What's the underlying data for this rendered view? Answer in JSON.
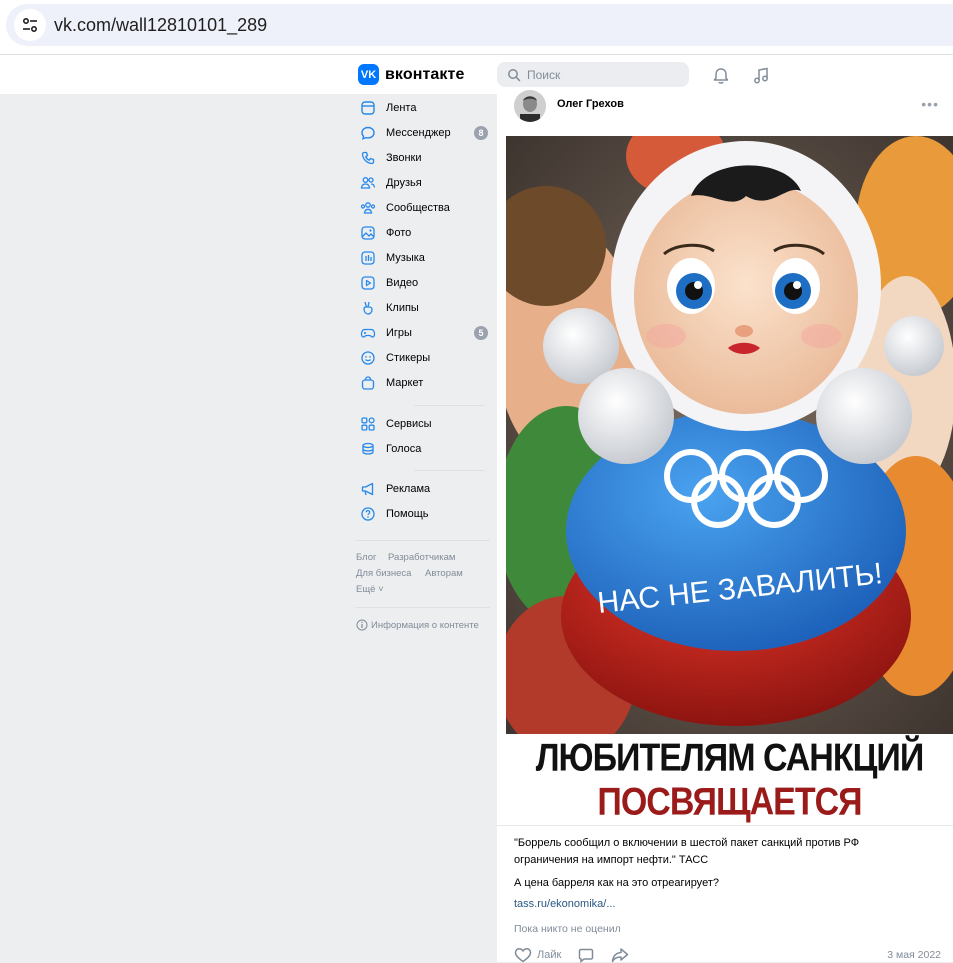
{
  "browser": {
    "url": "vk.com/wall12810101_289"
  },
  "header": {
    "logo_text": "вконтакте",
    "logo_mark": "VK",
    "search_placeholder": "Поиск",
    "icons": [
      "bell-icon",
      "music-icon"
    ]
  },
  "sidebar": {
    "items": [
      {
        "label": "Лента",
        "icon": "news-icon"
      },
      {
        "label": "Мессенджер",
        "icon": "chat-icon",
        "badge": "8"
      },
      {
        "label": "Звонки",
        "icon": "phone-icon"
      },
      {
        "label": "Друзья",
        "icon": "friends-icon"
      },
      {
        "label": "Сообщества",
        "icon": "communities-icon"
      },
      {
        "label": "Фото",
        "icon": "photo-icon"
      },
      {
        "label": "Музыка",
        "icon": "music-icon"
      },
      {
        "label": "Видео",
        "icon": "video-icon"
      },
      {
        "label": "Клипы",
        "icon": "clips-icon"
      },
      {
        "label": "Игры",
        "icon": "games-icon",
        "badge": "5"
      },
      {
        "label": "Стикеры",
        "icon": "smile-icon"
      },
      {
        "label": "Маркет",
        "icon": "bag-icon"
      }
    ],
    "items2": [
      {
        "label": "Сервисы",
        "icon": "grid-icon"
      },
      {
        "label": "Голоса",
        "icon": "coins-icon"
      }
    ],
    "items3": [
      {
        "label": "Реклама",
        "icon": "megaphone-icon"
      },
      {
        "label": "Помощь",
        "icon": "help-icon"
      }
    ],
    "footer": {
      "blog": "Блог",
      "developers": "Разработчикам",
      "business": "Для бизнеса",
      "authors": "Авторам",
      "more": "Ещё ˅",
      "content_info": "Информация о контенте"
    }
  },
  "post": {
    "author": "Олег Грехов",
    "menu": "•••",
    "image": {
      "toy_text": "НАС НЕ ЗАВАЛИТЬ!",
      "caption_line1": "ЛЮБИТЕЛЯМ САНКЦИЙ",
      "caption_line2": "ПОСВЯЩАЕТСЯ"
    },
    "text_line1": "\"Боррель сообщил о включении в шестой пакет санкций против РФ",
    "text_line2": "ограничения на импорт нефти.\" ТАСС",
    "text_line3": "А цена барреля как на это отреагирует?",
    "link": "tass.ru/ekonomika/...",
    "likes_note": "Пока никто не оценил",
    "like_label": "Лайк",
    "date": "3 мая 2022"
  },
  "colors": {
    "accent": "#0077ff",
    "link": "#2a5885",
    "muted": "#818c99",
    "page_bg": "#edeef0",
    "caption_red": "#9b1a1a"
  }
}
